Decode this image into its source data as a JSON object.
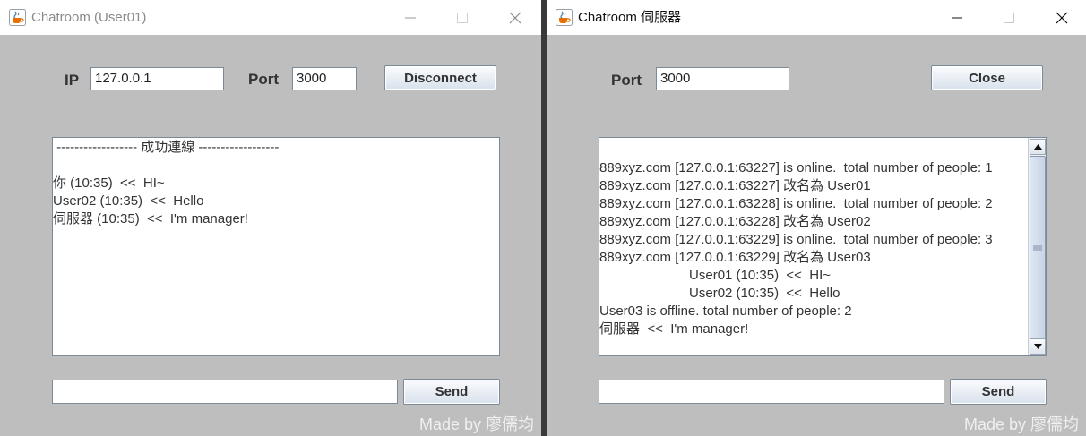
{
  "client": {
    "title": "Chatroom (User01)",
    "ip_label": "IP",
    "ip_value": "127.0.0.1",
    "port_label": "Port",
    "port_value": "3000",
    "disconnect_label": "Disconnect",
    "chat_lines": [
      " ------------------ 成功連線 ------------------",
      "",
      "你 (10:35)  <<  HI~",
      "User02 (10:35)  <<  Hello",
      "伺服器 (10:35)  <<  I'm manager!"
    ],
    "message_input_value": "",
    "send_label": "Send",
    "credit": "Made by 廖儒均"
  },
  "server": {
    "title": "Chatroom 伺服器",
    "port_label": "Port",
    "port_value": "3000",
    "close_label": "Close",
    "log_lines": [
      "",
      "889xyz.com [127.0.0.1:63227] is online.  total number of people: 1",
      "889xyz.com [127.0.0.1:63227] 改名為 User01",
      "889xyz.com [127.0.0.1:63228] is online.  total number of people: 2",
      "889xyz.com [127.0.0.1:63228] 改名為 User02",
      "889xyz.com [127.0.0.1:63229] is online.  total number of people: 3",
      "889xyz.com [127.0.0.1:63229] 改名為 User03",
      "                        User01 (10:35)  <<  HI~",
      "                        User02 (10:35)  <<  Hello",
      "User03 is offline. total number of people: 2",
      "伺服器  <<  I'm manager!"
    ],
    "message_input_value": "",
    "send_label": "Send",
    "credit": "Made by 廖儒均"
  },
  "icons": {
    "app": "java-coffee-cup-icon",
    "minimize": "minimize-icon",
    "maximize": "maximize-icon",
    "close": "close-icon",
    "scroll_up": "scroll-up-arrow-icon",
    "scroll_down": "scroll-down-arrow-icon"
  },
  "colors": {
    "window_bg": "#bebebe",
    "titlebar_bg": "#ffffff",
    "button_gradient_top": "#fbfcfe",
    "button_gradient_bottom": "#d8e1ec",
    "border": "#7a8a99"
  }
}
